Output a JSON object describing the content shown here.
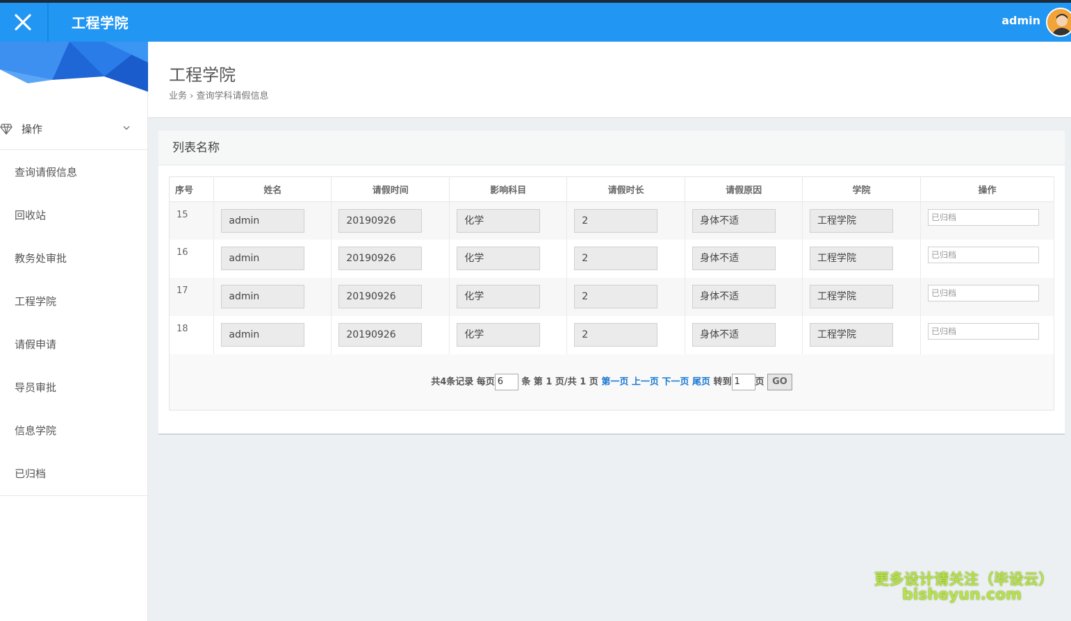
{
  "topbar": {
    "brand": "工程学院",
    "user": "admin"
  },
  "sidebar": {
    "menu_header": "操作",
    "items": [
      {
        "label": "查询请假信息"
      },
      {
        "label": "回收站"
      },
      {
        "label": "教务处审批"
      },
      {
        "label": "工程学院"
      },
      {
        "label": "请假申请"
      },
      {
        "label": "导员审批"
      },
      {
        "label": "信息学院"
      },
      {
        "label": "已归档"
      }
    ]
  },
  "page": {
    "title": "工程学院",
    "breadcrumb": "业务 › 查询学科请假信息"
  },
  "panel": {
    "title": "列表名称",
    "columns": [
      "序号",
      "姓名",
      "请假时间",
      "影响科目",
      "请假时长",
      "请假原因",
      "学院",
      "操作"
    ],
    "rows": [
      {
        "idx": "15",
        "name": "admin",
        "date": "20190926",
        "subject": "化学",
        "duration": "2",
        "reason": "身体不适",
        "college": "工程学院",
        "op_placeholder": "已归档"
      },
      {
        "idx": "16",
        "name": "admin",
        "date": "20190926",
        "subject": "化学",
        "duration": "2",
        "reason": "身体不适",
        "college": "工程学院",
        "op_placeholder": "已归档"
      },
      {
        "idx": "17",
        "name": "admin",
        "date": "20190926",
        "subject": "化学",
        "duration": "2",
        "reason": "身体不适",
        "college": "工程学院",
        "op_placeholder": "已归档"
      },
      {
        "idx": "18",
        "name": "admin",
        "date": "20190926",
        "subject": "化学",
        "duration": "2",
        "reason": "身体不适",
        "college": "工程学院",
        "op_placeholder": "已归档"
      }
    ]
  },
  "pager": {
    "total_text": "共4条记录 每页",
    "page_size": "6",
    "mid_text": "条 第 1 页/共 1 页",
    "first": "第一页",
    "prev": "上一页",
    "next": "下一页",
    "last": "尾页",
    "goto_text": "转到",
    "goto_value": "1",
    "page_suffix": "页",
    "go": "GO"
  },
  "watermark": {
    "line1": "更多设计请关注（毕设云）",
    "line2": "bisheyun.com"
  },
  "colors": {
    "topbar": "#2196f3",
    "link": "#1878d2",
    "watermark": "#b7e04a"
  }
}
